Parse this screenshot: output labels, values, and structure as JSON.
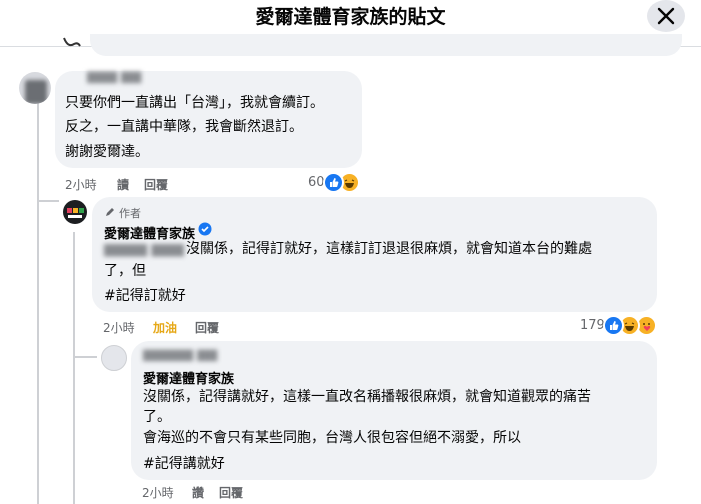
{
  "header": {
    "title": "愛爾達體育家族的貼文"
  },
  "comment1": {
    "line1": "只要你們一直講出「台灣」，我就會續訂。",
    "line2": "反之，一直講中華隊，我會斷然退訂。",
    "line3": "謝謝愛爾達。",
    "time": "2小時",
    "reply": "讀",
    "respond": "回覆",
    "reaction_count": "60"
  },
  "comment2": {
    "author_badge": "作者",
    "name": "愛爾達體育家族",
    "line1": "沒關係，記得訂就好，這樣訂訂退退很麻煩，就會知道本台的難處",
    "line2": "了，但",
    "line3": "#記得訂就好",
    "time": "2小時",
    "like": "加油",
    "respond": "回覆",
    "reaction_count": "179"
  },
  "comment3": {
    "name": "愛爾達體育家族",
    "line1": "沒關係，記得講就好，這樣一直改名稱播報很麻煩，就會知道觀眾的痛苦",
    "line2": "了。",
    "line3": "會海巡的不會只有某些同胞，台灣人很包容但絕不溺愛，所以",
    "line4": "#記得講就好",
    "time": "2小時",
    "reply": "讚",
    "respond": "回覆"
  },
  "icons": [
    "close-icon",
    "pencil-icon",
    "verified-badge-icon",
    "like-reaction-icon",
    "haha-reaction-icon",
    "care-reaction-icon"
  ],
  "colors": {
    "accent": "#1877f2",
    "highlight": "#e6a817",
    "bubble": "#f0f2f5",
    "secondary_text": "#65676b"
  }
}
